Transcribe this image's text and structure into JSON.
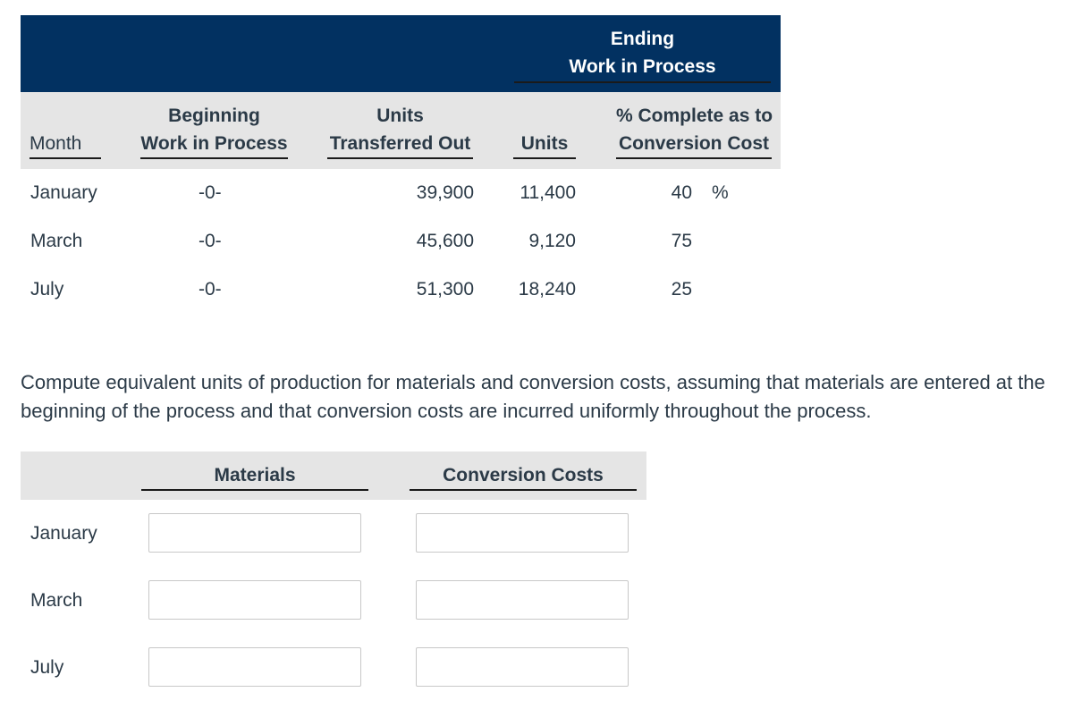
{
  "table": {
    "group_header": "Ending\nWork in Process",
    "group_header_lines": [
      "Ending",
      "Work in Process"
    ],
    "columns": {
      "month": "Month",
      "beginning_wip": [
        "Beginning",
        "Work in Process"
      ],
      "transferred_out": [
        "Units",
        "Transferred Out"
      ],
      "ending_units": "Units",
      "pct_complete": [
        "% Complete as to",
        "Conversion Cost"
      ]
    },
    "rows": [
      {
        "month": "January",
        "beginning_wip": "-0-",
        "transferred_out": "39,900",
        "ending_units": "11,400",
        "pct_complete": "40",
        "pct_sign": "%"
      },
      {
        "month": "March",
        "beginning_wip": "-0-",
        "transferred_out": "45,600",
        "ending_units": "9,120",
        "pct_complete": "75",
        "pct_sign": ""
      },
      {
        "month": "July",
        "beginning_wip": "-0-",
        "transferred_out": "51,300",
        "ending_units": "18,240",
        "pct_complete": "25",
        "pct_sign": ""
      }
    ]
  },
  "instructions": "Compute equivalent units of production for materials and conversion costs, assuming that materials are entered at the beginning of the process and that conversion costs are incurred uniformly throughout the process.",
  "answer": {
    "columns": {
      "materials": "Materials",
      "conversion": "Conversion Costs"
    },
    "rows": [
      {
        "month": "January",
        "materials": "",
        "conversion": ""
      },
      {
        "month": "March",
        "materials": "",
        "conversion": ""
      },
      {
        "month": "July",
        "materials": "",
        "conversion": ""
      }
    ]
  }
}
